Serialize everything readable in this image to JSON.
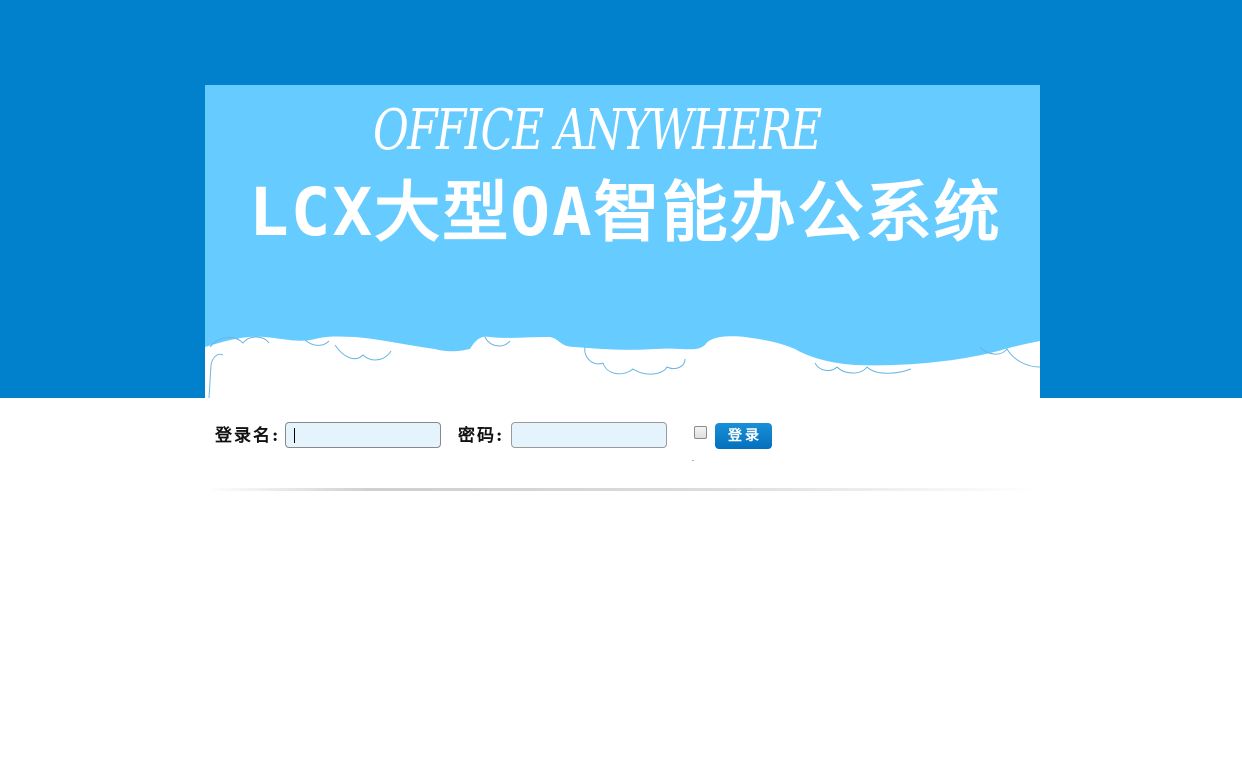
{
  "banner": {
    "subtitle": "OFFICE ANYWHERE",
    "title": "LCX大型OA智能办公系统"
  },
  "login": {
    "username_label": "登录名:",
    "username_value": "",
    "password_label": "密码:",
    "password_value": "",
    "remember_checked": false,
    "submit_label": "登录"
  },
  "colors": {
    "top_band": "#0180cc",
    "banner_bg": "#66cbfe",
    "input_bg": "#e5f4fc",
    "button_bg": "#0a7fc9"
  }
}
